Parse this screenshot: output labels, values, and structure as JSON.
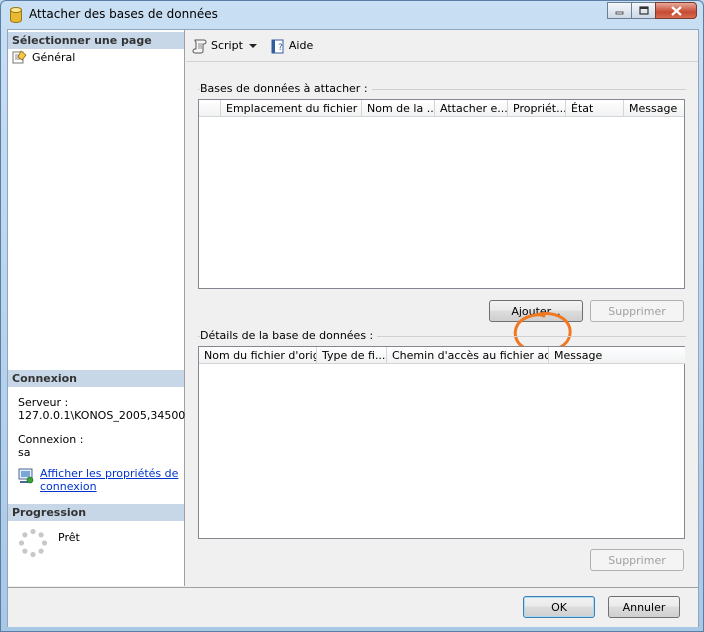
{
  "window": {
    "title": "Attacher des bases de données"
  },
  "left": {
    "select_page_header": "Sélectionner une page",
    "pages": [
      {
        "label": "Général",
        "icon": "page-icon"
      }
    ],
    "connection_header": "Connexion",
    "server_label": "Serveur :",
    "server_value": "127.0.0.1\\KONOS_2005,34500",
    "connection_label": "Connexion :",
    "connection_value": "sa",
    "view_props_link_line1": "Afficher les propriétés de",
    "view_props_link_line2": "connexion",
    "progress_header": "Progression",
    "progress_status": "Prêt"
  },
  "toolbar": {
    "script_label": "Script",
    "help_label": "Aide"
  },
  "attach_group": {
    "label": "Bases de données à attacher :",
    "columns": [
      "",
      "Emplacement du fichier ...",
      "Nom de la ...",
      "Attacher e...",
      "Propriét...",
      "État",
      "Message"
    ],
    "rows": [],
    "add_button": "Ajouter...",
    "remove_button": "Supprimer"
  },
  "details_group": {
    "label": "Détails de la base de données :",
    "columns": [
      "Nom du fichier d'orig...",
      "Type de fi...",
      "Chemin d'accès au fichier act...",
      "Message"
    ],
    "rows": [],
    "remove_button": "Supprimer"
  },
  "dialog": {
    "ok": "OK",
    "cancel": "Annuler"
  },
  "colors": {
    "highlight_circle": "#f07820",
    "section_header_bg": "#c7d7e8",
    "link": "#0033cc"
  }
}
